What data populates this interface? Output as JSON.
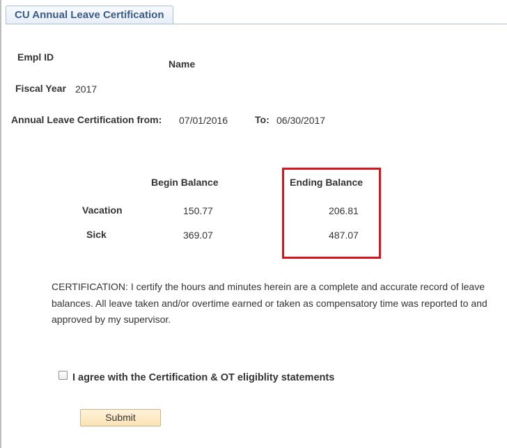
{
  "tab": {
    "label": "CU Annual Leave Certification"
  },
  "employee": {
    "empl_id_label": "Empl ID",
    "empl_id_value": "",
    "name_label": "Name",
    "name_value": "",
    "fiscal_year_label": "Fiscal Year",
    "fiscal_year_value": "2017"
  },
  "period": {
    "from_label": "Annual Leave Certification from:",
    "from_value": "07/01/2016",
    "to_label": "To:",
    "to_value": "06/30/2017"
  },
  "balances": {
    "begin_header": "Begin Balance",
    "ending_header": "Ending Balance",
    "rows": [
      {
        "label": "Vacation",
        "begin": "150.77",
        "ending": "206.81"
      },
      {
        "label": "Sick",
        "begin": "369.07",
        "ending": "487.07"
      }
    ],
    "highlight_color": "#d9141b"
  },
  "certification": {
    "text": "CERTIFICATION: I certify the hours and minutes herein are a complete and accurate record of leave balances. All leave taken and/or overtime earned or taken as compensatory time was reported to and approved by my supervisor."
  },
  "agreement": {
    "label": "I agree with the Certification & OT eligiblity statements",
    "checked": false
  },
  "submit": {
    "label": "Submit"
  }
}
